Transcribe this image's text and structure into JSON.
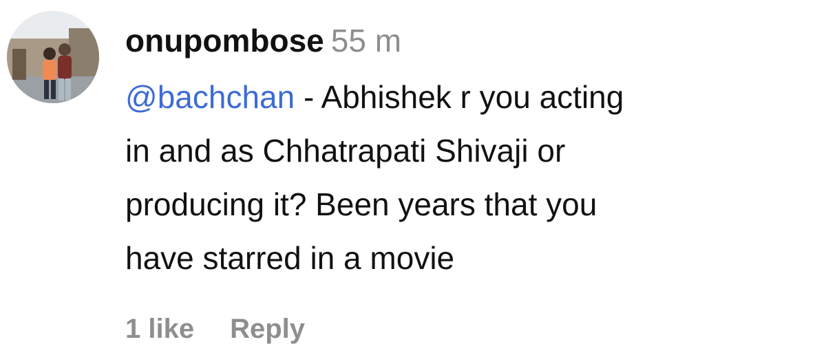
{
  "comment": {
    "username": "onupombose",
    "time": "55 m",
    "mention": "@bachchan",
    "text_after_mention": " - Abhishek r you acting",
    "text_lines": [
      "in and as Chhatrapati Shivaji or",
      "producing it? Been years that you",
      "have starred in a movie"
    ],
    "likes_label": "1 like",
    "reply_label": "Reply"
  },
  "colors": {
    "mention": "#3d6bd6",
    "meta_text": "#8e8e8e",
    "body_text": "#111111"
  },
  "icons": {
    "avatar": "profile-photo"
  }
}
